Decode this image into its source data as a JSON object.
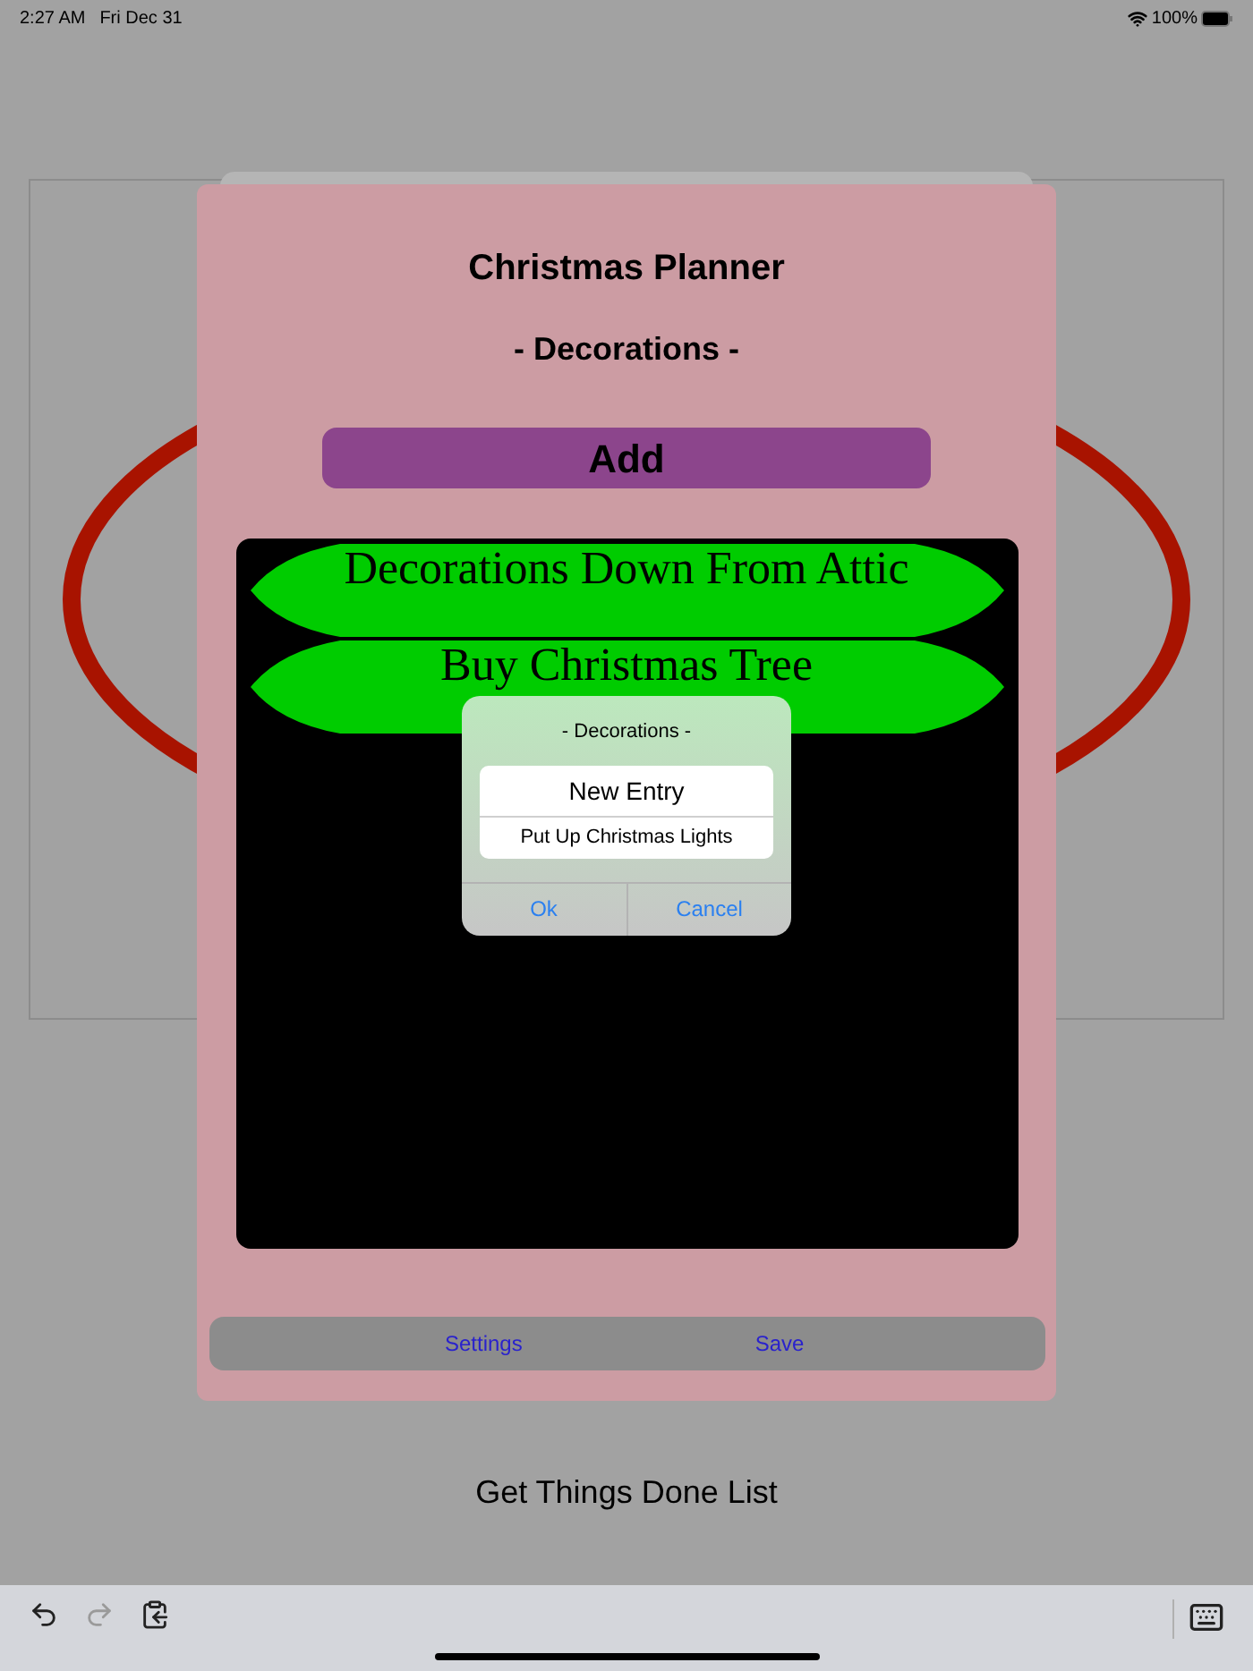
{
  "status_bar": {
    "time": "2:27 AM",
    "date": "Fri Dec 31",
    "battery": "100%"
  },
  "page": {
    "footer_title": "Get Things Done List"
  },
  "planner": {
    "title": "Christmas Planner",
    "subtitle": "- Decorations -",
    "add_button": "Add",
    "items": [
      {
        "text": "Decorations Down From Attic"
      },
      {
        "text": "Buy Christmas Tree"
      }
    ],
    "toolbar": [
      "Settings",
      "Save"
    ]
  },
  "alert": {
    "title": "- Decorations -",
    "fields": [
      {
        "kind": "large",
        "value": "New Entry"
      },
      {
        "kind": "small",
        "value": "Put Up Christmas Lights"
      }
    ],
    "buttons": [
      "Ok",
      "Cancel"
    ]
  },
  "keyboard_bar": {
    "redo_disabled": true
  }
}
